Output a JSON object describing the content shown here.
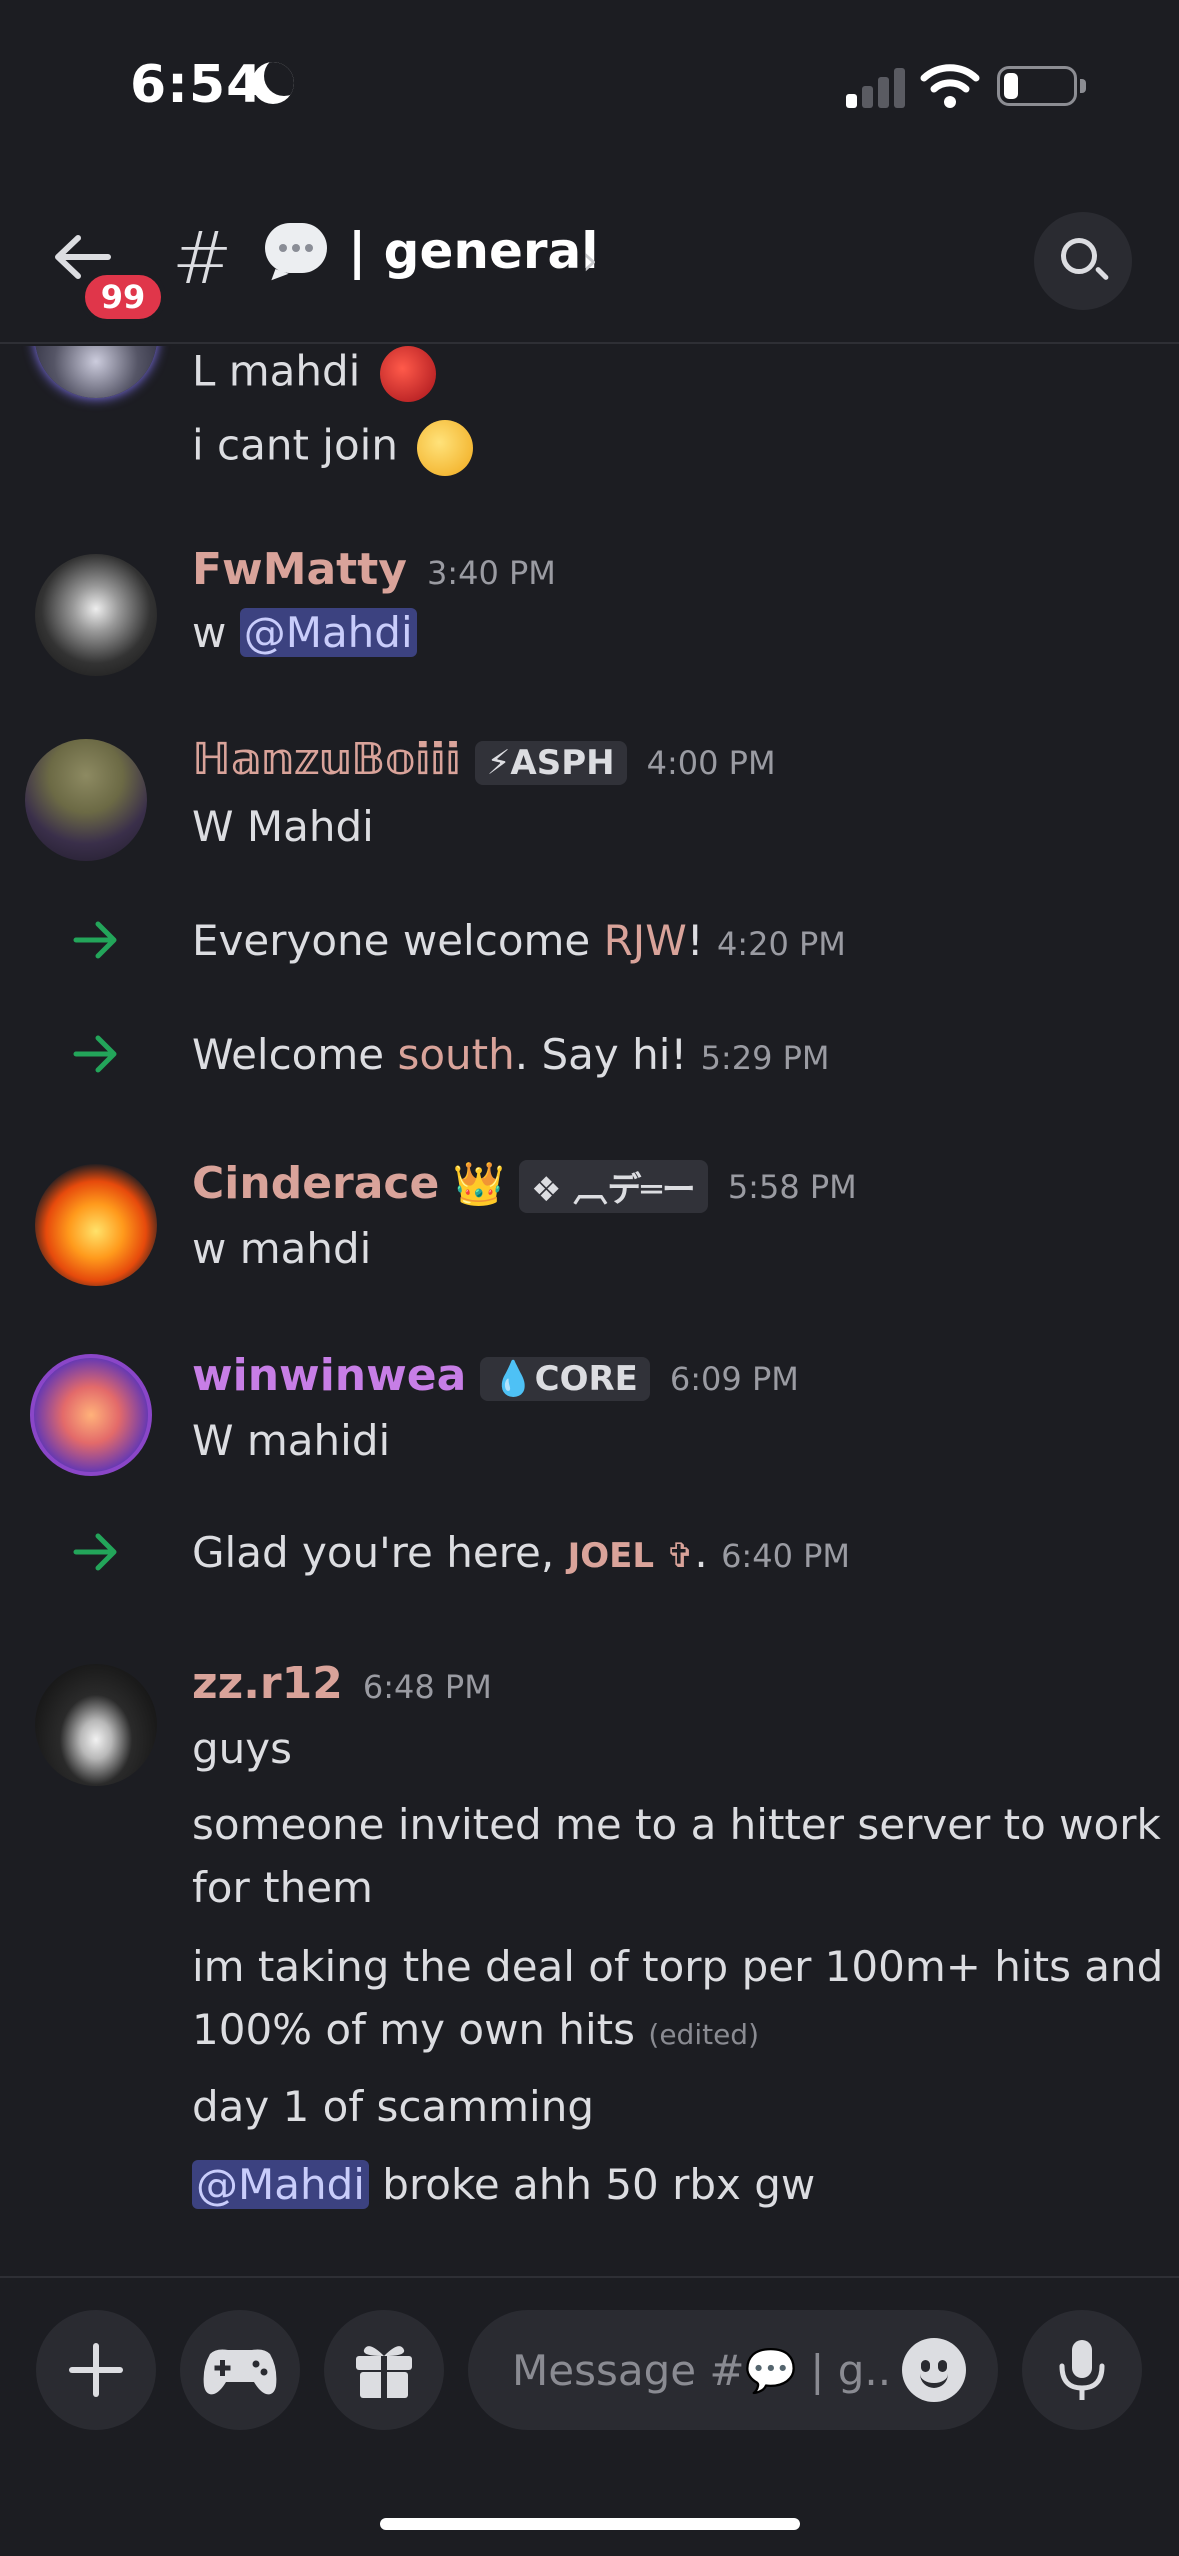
{
  "status_bar": {
    "time": "6:54"
  },
  "header": {
    "back_badge": "99",
    "channel_hash": "#",
    "channel_name": "| general",
    "chevron": "›"
  },
  "messages": [
    {
      "kind": "continuation",
      "lines": [
        "L mahdi",
        "i cant join"
      ]
    },
    {
      "kind": "message",
      "author": "FwMatty",
      "author_color": "#d9a39a",
      "time": "3:40 PM",
      "prefix": "w ",
      "mention": "@Mahdi"
    },
    {
      "kind": "message",
      "author": "ℍ𝕒𝕟𝕫𝕦𝔹𝕠𝕚𝕚𝕚",
      "author_color": "#d9a39a",
      "tag": "⚡ASPH",
      "time": "4:00 PM",
      "text": "W Mahdi"
    },
    {
      "kind": "system",
      "pre": "Everyone welcome ",
      "name": "RJW",
      "post": "!",
      "time": "4:20 PM"
    },
    {
      "kind": "system",
      "pre": "Welcome ",
      "name": "south",
      "post": ". Say hi!",
      "time": "5:29 PM"
    },
    {
      "kind": "message",
      "author": "Cinderace",
      "author_badge": "👑",
      "author_color": "#d9a39a",
      "tag": "❖ ︹デ═ー",
      "time": "5:58 PM",
      "text": "w mahdi"
    },
    {
      "kind": "message",
      "author": "winwinwea",
      "author_color": "#c77ee6",
      "tag": "💧CORE",
      "time": "6:09 PM",
      "text": "W mahidi"
    },
    {
      "kind": "system",
      "pre": "Glad you're here, ",
      "name": "JOEL ✞",
      "post": ".",
      "time": "6:40 PM"
    },
    {
      "kind": "message",
      "author": "zz.r12",
      "author_color": "#d9a39a",
      "time": "6:48 PM",
      "lines": [
        "guys",
        "someone invited me to a hitter server to work",
        "for them",
        "im taking the deal of torp per 100m+ hits and",
        "100% of my own hits",
        "day 1 of scamming"
      ],
      "edited": "(edited)",
      "last_mention": "@Mahdi",
      "last_text": " broke ahh 50 rbx gw"
    }
  ],
  "composer": {
    "placeholder": "Message #💬 | g.."
  },
  "colors": {
    "background": "#1c1d22",
    "accent_green": "#23a55a",
    "mention_bg": "#3c4280",
    "badge_red": "#e0364a"
  },
  "icons": [
    "moon-icon",
    "signal-icon",
    "wifi-icon",
    "battery-icon",
    "back-arrow-icon",
    "chat-bubble-icon",
    "search-icon",
    "join-arrow-icon",
    "plus-icon",
    "gamepad-icon",
    "gift-icon",
    "emoji-icon",
    "microphone-icon"
  ]
}
